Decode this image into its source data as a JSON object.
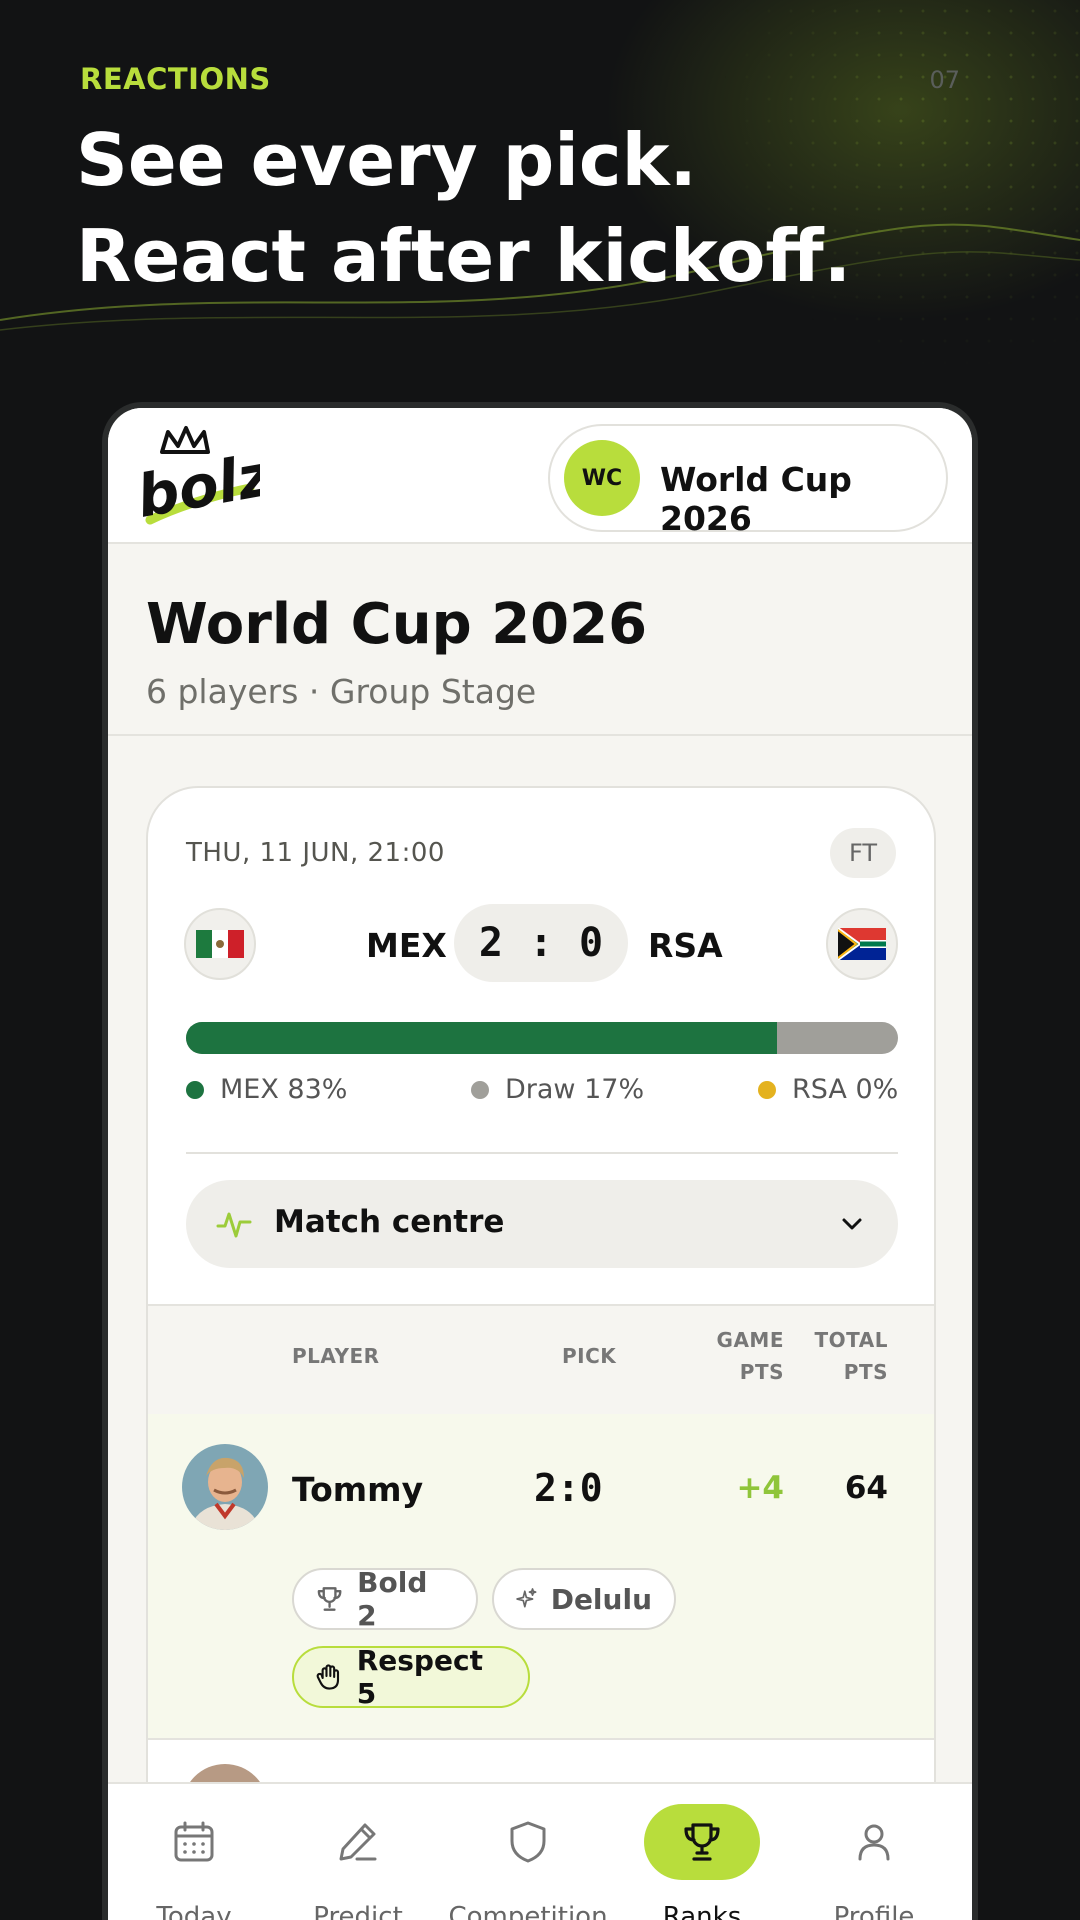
{
  "hero": {
    "eyebrow": "REACTIONS",
    "page_number": "07",
    "headline_line1": "See every pick.",
    "headline_line2": "React after kickoff."
  },
  "app": {
    "logo_text": "bolz",
    "competition_badge": "WC",
    "competition_name": "World Cup 2026"
  },
  "league": {
    "title": "World Cup 2026",
    "subtitle": "6 players · Group Stage"
  },
  "match": {
    "kickoff": "THU, 11 JUN, 21:00",
    "status": "FT",
    "home_team": "MEX",
    "away_team": "RSA",
    "home_score": "2",
    "separator": ":",
    "away_score": "0",
    "prediction_share": {
      "home": 0.83,
      "draw": 0.17,
      "away": 0.0
    },
    "legend": {
      "home": "MEX 83%",
      "draw": "Draw 17%",
      "away": "RSA 0%"
    },
    "match_centre_label": "Match centre"
  },
  "table": {
    "headers": {
      "player": "PLAYER",
      "pick": "PICK",
      "game_pts_line1": "GAME",
      "game_pts_line2": "PTS",
      "total_pts_line1": "TOTAL",
      "total_pts_line2": "PTS"
    },
    "rows": [
      {
        "name": "Tommy",
        "pick": "2:0",
        "game_pts": "+4",
        "total_pts": "64",
        "reactions": [
          {
            "icon": "trophy-icon",
            "label": "Bold 2"
          },
          {
            "icon": "sparkles-icon",
            "label": "Delulu"
          },
          {
            "icon": "hand-icon",
            "label": "Respect 5"
          }
        ]
      }
    ]
  },
  "tabs": [
    {
      "icon": "calendar-icon",
      "label": "Today"
    },
    {
      "icon": "pencil-icon",
      "label": "Predict"
    },
    {
      "icon": "shield-icon",
      "label": "Competition"
    },
    {
      "icon": "trophy-icon",
      "label": "Ranks",
      "active": true
    },
    {
      "icon": "user-icon",
      "label": "Profile"
    }
  ],
  "colors": {
    "accent": "#b8dd3c",
    "home": "#1d7340",
    "draw": "#a09f9a",
    "away": "#e4b21f",
    "background": "#121314"
  }
}
